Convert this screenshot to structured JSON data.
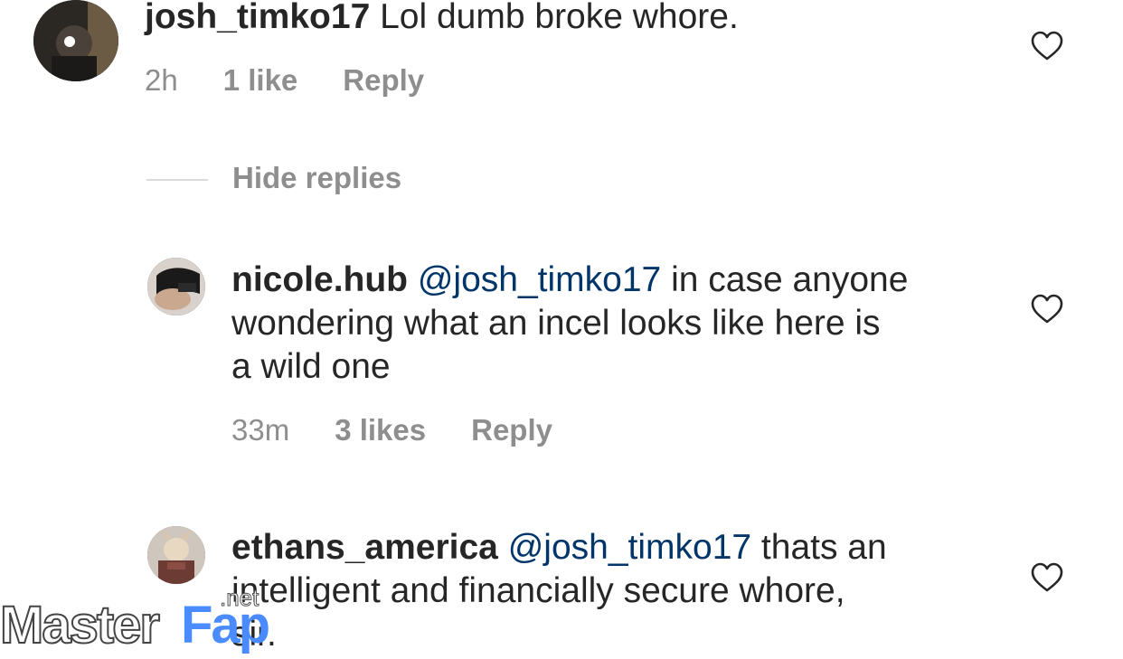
{
  "comments": [
    {
      "username": "josh_timko17",
      "body_parts": [
        " Lol dumb broke whore."
      ],
      "time": "2h",
      "likes": "1 like",
      "reply": "Reply"
    },
    {
      "username": "nicole.hub",
      "mention": "@josh_timko17",
      "body_line1": " in case anyone",
      "body_line2": "wondering what an incel looks like here is",
      "body_line3": "a wild one",
      "time": "33m",
      "likes": "3 likes",
      "reply": "Reply"
    },
    {
      "username": "ethans_america",
      "mention": "@josh_timko17",
      "body_line1": " thats an",
      "body_line2": "intelligent and financially secure whore,",
      "body_line3": "sir."
    }
  ],
  "hide_replies": "Hide replies",
  "icons": {
    "like": "heart-outline-icon"
  },
  "watermark": {
    "master": "Master",
    "fap": "Fap",
    "net": ".net"
  }
}
